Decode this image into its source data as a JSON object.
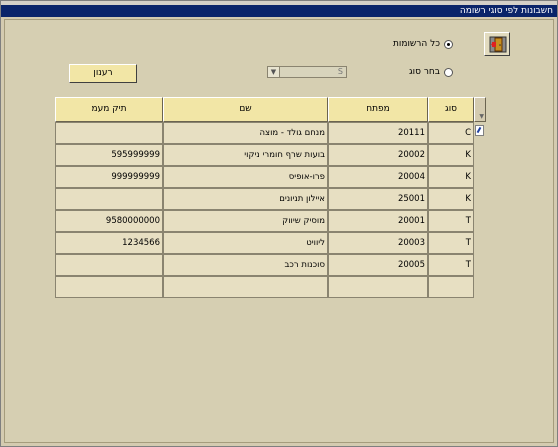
{
  "window": {
    "title": "חשבונות לפי סוגי רשומה"
  },
  "filters": {
    "all_label": "כל הרשומות",
    "by_type_label": "בחר סוג",
    "selected": "all",
    "type_value": "S"
  },
  "toolbar": {
    "refresh_label": "רענון",
    "action_icon": "exit-door-icon"
  },
  "table": {
    "headers": {
      "type": "סוג",
      "key": "מפתח",
      "name": "שם",
      "vat_file": "תיק מעמ"
    },
    "rows": [
      {
        "type": "C",
        "key": "20111",
        "name": "מנחם גולד - מוצה",
        "vat_file": ""
      },
      {
        "type": "K",
        "key": "20002",
        "name": "בועות שרף חומרי ניקוי",
        "vat_file": "595999999"
      },
      {
        "type": "K",
        "key": "20004",
        "name": "פרו-אופיס",
        "vat_file": "999999999"
      },
      {
        "type": "K",
        "key": "25001",
        "name": "איילון תניונים",
        "vat_file": ""
      },
      {
        "type": "T",
        "key": "20001",
        "name": "מוסיק שיווק",
        "vat_file": "9580000000"
      },
      {
        "type": "T",
        "key": "20003",
        "name": "ליוויט",
        "vat_file": "1234566"
      },
      {
        "type": "T",
        "key": "20005",
        "name": "סוכנות רכב",
        "vat_file": ""
      },
      {
        "type": "",
        "key": "",
        "name": "",
        "vat_file": ""
      }
    ]
  }
}
